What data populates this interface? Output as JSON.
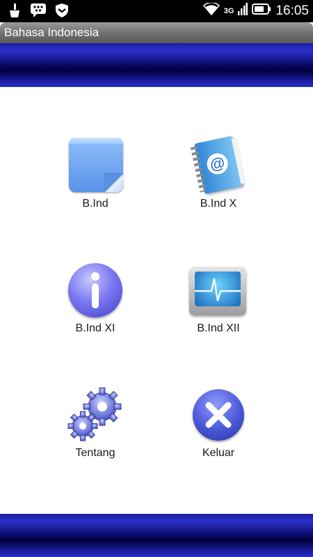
{
  "status_bar": {
    "network": "3G",
    "time": "16:05"
  },
  "app": {
    "title": "Bahasa Indonesia"
  },
  "menu": [
    {
      "label": "B.Ind",
      "icon": "sticky-note-icon"
    },
    {
      "label": "B.Ind X",
      "icon": "address-book-icon"
    },
    {
      "label": "B.Ind XI",
      "icon": "info-icon"
    },
    {
      "label": "B.Ind XII",
      "icon": "monitor-pulse-icon"
    },
    {
      "label": "Tentang",
      "icon": "gears-icon"
    },
    {
      "label": "Keluar",
      "icon": "close-x-icon"
    }
  ],
  "colors": {
    "band_dark": "#000038",
    "band_light": "#2b2fc7",
    "accent_blue": "#4a57d6"
  }
}
